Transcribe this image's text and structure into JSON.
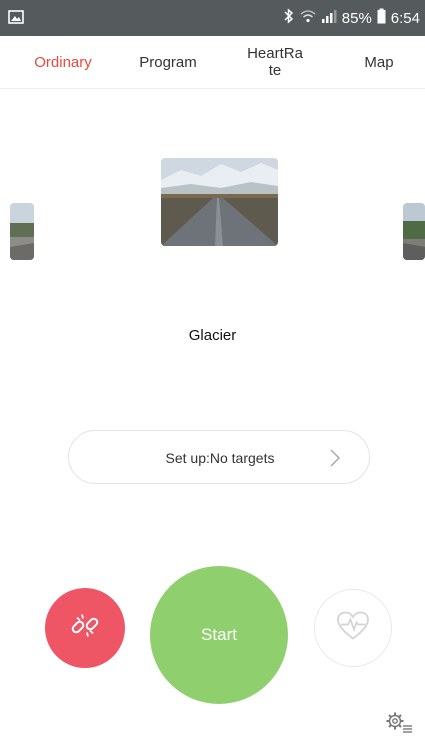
{
  "status_bar": {
    "battery": "85%",
    "time": "6:54",
    "icons": [
      "image-icon",
      "bluetooth-icon",
      "wifi-icon",
      "signal-icon",
      "battery-icon"
    ]
  },
  "tabs": [
    {
      "label": "Ordinary",
      "active": true
    },
    {
      "label": "Program",
      "active": false
    },
    {
      "label": "HeartRa\nte",
      "active": false
    },
    {
      "label": "Map",
      "active": false
    }
  ],
  "carousel": {
    "current_scene": "Glacier"
  },
  "setup": {
    "label": "Set up:No targets"
  },
  "controls": {
    "start_label": "Start",
    "disconnect_icon": "broken-link-icon",
    "heart_icon": "heart-rate-icon",
    "settings_icon": "settings-gear-icon"
  },
  "colors": {
    "accent_red": "#e8493c",
    "disconnect_red": "#ee5565",
    "start_green": "#90cf6e",
    "status_bar": "#555a5c"
  }
}
